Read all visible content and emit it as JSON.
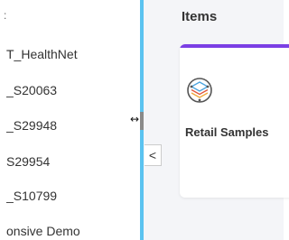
{
  "left_list": {
    "top_glyph": ":",
    "items": [
      {
        "label": "T_HealthNet"
      },
      {
        "label": "_S20063"
      },
      {
        "label": "_S29948"
      },
      {
        "label": "S29954"
      },
      {
        "label": "_S10799"
      },
      {
        "label": "onsive Demo"
      }
    ]
  },
  "splitter": {
    "resize_cursor_glyph": "↔",
    "collapse_glyph": "<"
  },
  "main": {
    "title": "Items",
    "cards": [
      {
        "label": "Retail Samples",
        "icon": "layers-icon",
        "accent_color": "#7b3fe4"
      }
    ]
  },
  "colors": {
    "splitter": "#5bc3f0",
    "accent": "#7b3fe4",
    "background": "#f4f5f8"
  }
}
